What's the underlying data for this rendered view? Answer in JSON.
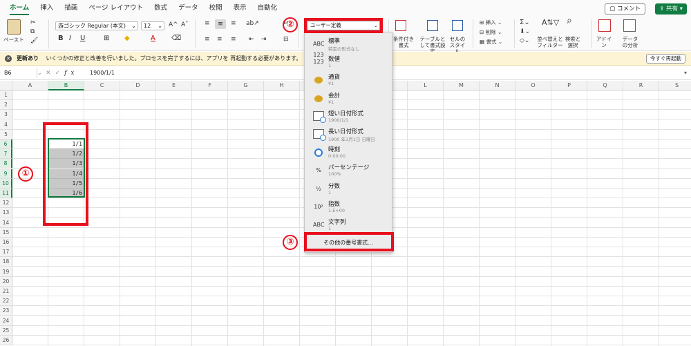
{
  "tabs": [
    "ホーム",
    "挿入",
    "描画",
    "ページ レイアウト",
    "数式",
    "データ",
    "校閲",
    "表示",
    "自動化"
  ],
  "active_tab": "ホーム",
  "header": {
    "comment_label": "コメント",
    "share_label": "共有"
  },
  "ribbon": {
    "paste_label": "ペースト",
    "font_name": "游ゴシック Regular (本文)",
    "font_size": "12",
    "number_format": "ユーザー定義",
    "cond_format_label": "条件付き書式",
    "table_format_label": "テーブルとして書式設定",
    "cell_style_label": "セルのスタイル",
    "insert_label": "挿入",
    "delete_label": "削除",
    "format_label": "書式",
    "sort_filter_label": "並べ替えとフィルター",
    "find_select_label": "検索と選択",
    "addin_label": "アドイン",
    "analysis_label": "データの分析"
  },
  "infobar": {
    "title": "更新あり",
    "message": "いくつかの修正と改善を行いました。プロセスを完了するには、アプリを 再起動する必要があります。",
    "button": "今すぐ再起動"
  },
  "formula_bar": {
    "name_box": "B6",
    "fx": "fx",
    "value": "1900/1/1"
  },
  "columns": [
    "A",
    "B",
    "C",
    "D",
    "E",
    "F",
    "G",
    "H",
    "I",
    "J",
    "K",
    "L",
    "M",
    "N",
    "O",
    "P",
    "Q",
    "R",
    "S"
  ],
  "rows": [
    "1",
    "2",
    "3",
    "4",
    "5",
    "6",
    "7",
    "8",
    "9",
    "10",
    "11",
    "12",
    "13",
    "14",
    "15",
    "16",
    "17",
    "18",
    "19",
    "20",
    "21",
    "22",
    "23",
    "24",
    "25",
    "26"
  ],
  "cells_b": [
    "1/1",
    "1/2",
    "1/3",
    "1/4",
    "1/5",
    "1/6"
  ],
  "format_menu": [
    {
      "icon": "ABC 123",
      "label": "標準",
      "sub": "特定の形式なし"
    },
    {
      "icon": "123",
      "label": "数値",
      "sub": "1"
    },
    {
      "icon": "coins-icon",
      "label": "通貨",
      "sub": "¥1"
    },
    {
      "icon": "coins-icon",
      "label": "会計",
      "sub": "¥1"
    },
    {
      "icon": "calendar-icon",
      "label": "短い日付形式",
      "sub": "1900/1/1"
    },
    {
      "icon": "calendar-icon",
      "label": "長い日付形式",
      "sub": "1900 年1月1日 日曜日"
    },
    {
      "icon": "clock-icon",
      "label": "時刻",
      "sub": "0:00:00"
    },
    {
      "icon": "%",
      "label": "パーセンテージ",
      "sub": "100%"
    },
    {
      "icon": "½",
      "label": "分数",
      "sub": "1"
    },
    {
      "icon": "10²",
      "label": "指数",
      "sub": "1.E+00"
    },
    {
      "icon": "ABC",
      "label": "文字列",
      "sub": "1"
    }
  ],
  "more_formats": "その他の番号書式...",
  "annotations": [
    "①",
    "②",
    "③"
  ],
  "colors": {
    "accent": "#107c41",
    "annotation": "#e8101c",
    "infobar": "#fdf4d6"
  }
}
